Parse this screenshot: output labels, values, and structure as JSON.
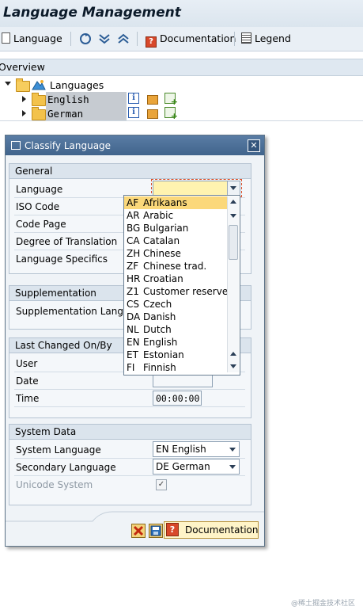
{
  "window": {
    "title": "Language Management"
  },
  "toolbar": {
    "language_label": "Language",
    "documentation_label": "Documentation",
    "legend_label": "Legend"
  },
  "overview": {
    "title": "Overview",
    "tree": {
      "root_label": "Languages",
      "children": [
        {
          "label": "English"
        },
        {
          "label": "German"
        }
      ]
    }
  },
  "dialog": {
    "title": "Classify Language",
    "general": {
      "title": "General",
      "fields": {
        "language": "Language",
        "iso_code": "ISO Code",
        "code_page": "Code Page",
        "degree_of_translation": "Degree of Translation",
        "language_specifics": "Language Specifics"
      }
    },
    "supplementation": {
      "title": "Supplementation",
      "field_label": "Supplementation Langua"
    },
    "last_changed": {
      "title": "Last Changed On/By",
      "user_label": "User",
      "date_label": "Date",
      "time_label": "Time",
      "time_value": "00:00:00"
    },
    "system_data": {
      "title": "System Data",
      "system_language_label": "System Language",
      "system_language_value": "EN English",
      "secondary_language_label": "Secondary Language",
      "secondary_language_value": "DE German",
      "unicode_label": "Unicode System",
      "unicode_checked": true
    },
    "footer": {
      "documentation_label": "Documentation"
    }
  },
  "dropdown": {
    "selected_index": 0,
    "options": [
      {
        "code": "AF",
        "name": "Afrikaans"
      },
      {
        "code": "AR",
        "name": "Arabic"
      },
      {
        "code": "BG",
        "name": "Bulgarian"
      },
      {
        "code": "CA",
        "name": "Catalan"
      },
      {
        "code": "ZH",
        "name": "Chinese"
      },
      {
        "code": "ZF",
        "name": "Chinese trad."
      },
      {
        "code": "HR",
        "name": "Croatian"
      },
      {
        "code": "Z1",
        "name": "Customer reserve"
      },
      {
        "code": "CS",
        "name": "Czech"
      },
      {
        "code": "DA",
        "name": "Danish"
      },
      {
        "code": "NL",
        "name": "Dutch"
      },
      {
        "code": "EN",
        "name": "English"
      },
      {
        "code": "ET",
        "name": "Estonian"
      },
      {
        "code": "FI",
        "name": "Finnish"
      }
    ]
  },
  "watermark": "@稀土掘金技术社区",
  "colors": {
    "selection": "#fbd87a",
    "dialog_header": "#41648c",
    "field_highlight": "#fff3b0"
  }
}
